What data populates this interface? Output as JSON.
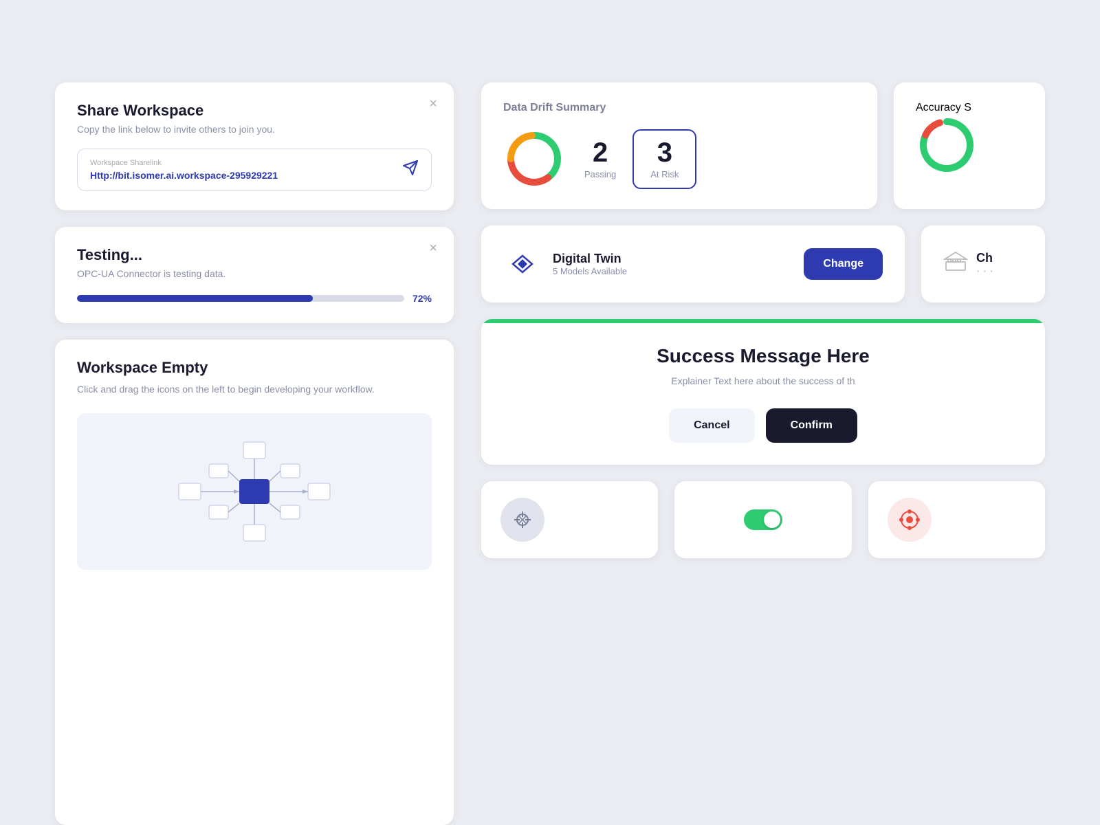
{
  "page": {
    "bg_color": "#eaecf2"
  },
  "share_workspace": {
    "title": "Share Workspace",
    "subtitle": "Copy the link below to invite others to join you.",
    "link_label": "Workspace Sharelink",
    "link_url": "Http://bit.isomer.ai.workspace-295929221",
    "close_label": "×"
  },
  "testing": {
    "title": "Testing...",
    "subtitle": "OPC-UA Connector is testing data.",
    "progress": 72,
    "progress_label": "72%",
    "close_label": "×"
  },
  "workspace_empty": {
    "title": "Workspace Empty",
    "subtitle": "Click and drag the icons on the left to begin developing your workflow.",
    "close_label": "×"
  },
  "data_drift": {
    "title": "Data Drift Summary",
    "passing_count": "2",
    "passing_label": "Passing",
    "at_risk_count": "3",
    "at_risk_label": "At Risk"
  },
  "digital_twin": {
    "name": "Digital Twin",
    "subtitle": "5 Models Available",
    "change_btn": "Change"
  },
  "success_message": {
    "title": "Success Message Here",
    "text": "Explainer Text here about the success of th",
    "cancel_btn": "Cancel",
    "confirm_btn": "Confirm"
  },
  "bottom_icons": {
    "icon1_color": "#8a8fa8",
    "icon2_color": "#2ecc71",
    "icon3_color": "#e74c3c"
  },
  "accuracy": {
    "title": "Accuracy S"
  },
  "right_partial": {
    "label": "Ch"
  }
}
